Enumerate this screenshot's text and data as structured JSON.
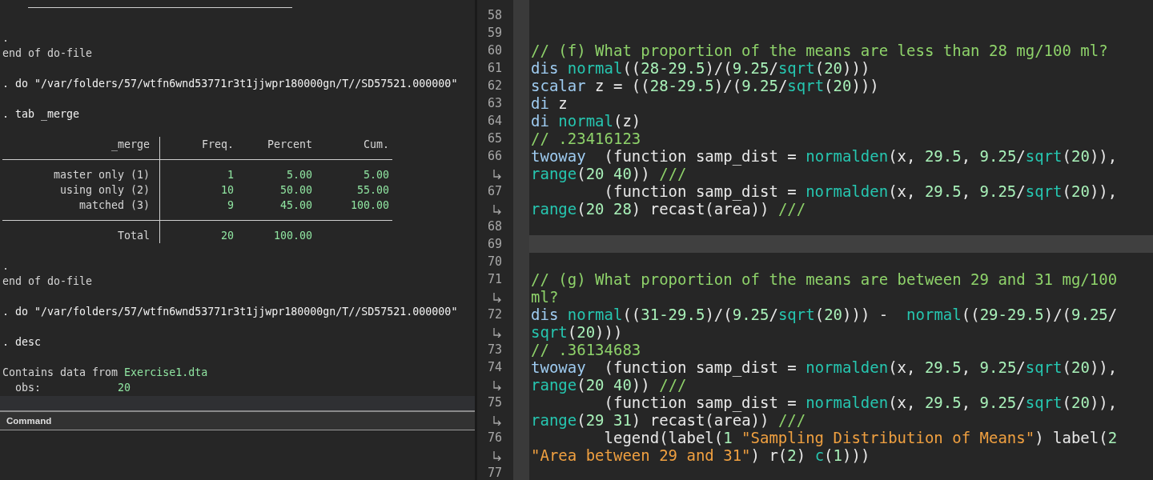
{
  "results": {
    "entries": [
      {
        "kind": "rule"
      },
      {
        "kind": "blank"
      },
      {
        "kind": "line",
        "segments": [
          {
            "kind": "plain",
            "text": "."
          }
        ]
      },
      {
        "kind": "line",
        "segments": [
          {
            "kind": "plain",
            "text": "end of do-file"
          }
        ]
      },
      {
        "kind": "blank"
      },
      {
        "kind": "line",
        "segments": [
          {
            "kind": "command",
            "text": ". do \"/var/folders/57/wtfn6wnd53771r3t1jjwpr180000gn/T//SD57521.000000\""
          }
        ]
      },
      {
        "kind": "blank"
      },
      {
        "kind": "line",
        "segments": [
          {
            "kind": "command",
            "text": ". tab _merge"
          }
        ]
      },
      {
        "kind": "blank"
      },
      {
        "kind": "table",
        "columns": [
          "_merge",
          "Freq.",
          "Percent",
          "Cum."
        ],
        "rows": [
          [
            "master only (1)",
            "1",
            "5.00",
            "5.00"
          ],
          [
            "using only (2)",
            "10",
            "50.00",
            "55.00"
          ],
          [
            "matched (3)",
            "9",
            "45.00",
            "100.00"
          ]
        ],
        "total": [
          "Total",
          "20",
          "100.00"
        ]
      },
      {
        "kind": "blank"
      },
      {
        "kind": "line",
        "segments": [
          {
            "kind": "plain",
            "text": "."
          }
        ]
      },
      {
        "kind": "line",
        "segments": [
          {
            "kind": "plain",
            "text": "end of do-file"
          }
        ]
      },
      {
        "kind": "blank"
      },
      {
        "kind": "line",
        "segments": [
          {
            "kind": "command",
            "text": ". do \"/var/folders/57/wtfn6wnd53771r3t1jjwpr180000gn/T//SD57521.000000\""
          }
        ]
      },
      {
        "kind": "blank"
      },
      {
        "kind": "line",
        "segments": [
          {
            "kind": "command",
            "text": ". desc"
          }
        ]
      },
      {
        "kind": "blank"
      },
      {
        "kind": "line",
        "segments": [
          {
            "kind": "plain",
            "text": "Contains data from "
          },
          {
            "kind": "result",
            "text": "Exercise1.dta"
          }
        ]
      },
      {
        "kind": "line",
        "segments": [
          {
            "kind": "plain",
            "text": "  obs:            "
          },
          {
            "kind": "result",
            "text": "20"
          }
        ]
      }
    ]
  },
  "command": {
    "title": "Command"
  },
  "editor": {
    "lines": [
      {
        "number": "58",
        "current": false
      },
      {
        "number": "59",
        "current": false
      },
      {
        "number": "60",
        "current": false,
        "wraps": [
          {
            "tokens": [
              {
                "kind": "comment",
                "text": "// (f) What proportion of the means are less than 28 mg/100 ml?"
              }
            ]
          }
        ]
      },
      {
        "number": "61",
        "current": false,
        "wraps": [
          {
            "tokens": [
              {
                "kind": "keyword",
                "text": "dis "
              },
              {
                "kind": "function",
                "text": "normal"
              },
              {
                "kind": "plain",
                "text": "(("
              },
              {
                "kind": "number",
                "text": "28-29.5"
              },
              {
                "kind": "plain",
                "text": ")/("
              },
              {
                "kind": "number",
                "text": "9.25"
              },
              {
                "kind": "plain",
                "text": "/"
              },
              {
                "kind": "function",
                "text": "sqrt"
              },
              {
                "kind": "plain",
                "text": "("
              },
              {
                "kind": "number",
                "text": "20"
              },
              {
                "kind": "plain",
                "text": ")))"
              }
            ]
          }
        ]
      },
      {
        "number": "62",
        "current": false,
        "wraps": [
          {
            "tokens": [
              {
                "kind": "keyword",
                "text": "scalar"
              },
              {
                "kind": "plain",
                "text": " z = (("
              },
              {
                "kind": "number",
                "text": "28-29.5"
              },
              {
                "kind": "plain",
                "text": ")/("
              },
              {
                "kind": "number",
                "text": "9.25"
              },
              {
                "kind": "plain",
                "text": "/"
              },
              {
                "kind": "function",
                "text": "sqrt"
              },
              {
                "kind": "plain",
                "text": "("
              },
              {
                "kind": "number",
                "text": "20"
              },
              {
                "kind": "plain",
                "text": ")))"
              }
            ]
          }
        ]
      },
      {
        "number": "63",
        "current": false,
        "wraps": [
          {
            "tokens": [
              {
                "kind": "keyword",
                "text": "di"
              },
              {
                "kind": "plain",
                "text": " z"
              }
            ]
          }
        ]
      },
      {
        "number": "64",
        "current": false,
        "wraps": [
          {
            "tokens": [
              {
                "kind": "keyword",
                "text": "di "
              },
              {
                "kind": "function",
                "text": "normal"
              },
              {
                "kind": "plain",
                "text": "(z)"
              }
            ]
          }
        ]
      },
      {
        "number": "65",
        "current": false,
        "wraps": [
          {
            "tokens": [
              {
                "kind": "comment",
                "text": "// .23416123"
              }
            ]
          }
        ]
      },
      {
        "number": "66",
        "current": false,
        "wraps": [
          {
            "tokens": [
              {
                "kind": "keyword",
                "text": "twoway"
              },
              {
                "kind": "plain",
                "text": "  (function samp_dist = "
              },
              {
                "kind": "function",
                "text": "normalden"
              },
              {
                "kind": "plain",
                "text": "(x, "
              },
              {
                "kind": "number",
                "text": "29.5"
              },
              {
                "kind": "plain",
                "text": ", "
              },
              {
                "kind": "number",
                "text": "9.25"
              },
              {
                "kind": "plain",
                "text": "/"
              },
              {
                "kind": "function",
                "text": "sqrt"
              },
              {
                "kind": "plain",
                "text": "("
              },
              {
                "kind": "number",
                "text": "20"
              },
              {
                "kind": "plain",
                "text": ")),"
              }
            ]
          },
          {
            "tokens": [
              {
                "kind": "function",
                "text": "range"
              },
              {
                "kind": "plain",
                "text": "("
              },
              {
                "kind": "number",
                "text": "20 40"
              },
              {
                "kind": "plain",
                "text": ")) "
              },
              {
                "kind": "comment",
                "text": "///"
              }
            ]
          }
        ]
      },
      {
        "number": "67",
        "current": false,
        "wraps": [
          {
            "tokens": [
              {
                "kind": "plain",
                "text": "        (function samp_dist = "
              },
              {
                "kind": "function",
                "text": "normalden"
              },
              {
                "kind": "plain",
                "text": "(x, "
              },
              {
                "kind": "number",
                "text": "29.5"
              },
              {
                "kind": "plain",
                "text": ", "
              },
              {
                "kind": "number",
                "text": "9.25"
              },
              {
                "kind": "plain",
                "text": "/"
              },
              {
                "kind": "function",
                "text": "sqrt"
              },
              {
                "kind": "plain",
                "text": "("
              },
              {
                "kind": "number",
                "text": "20"
              },
              {
                "kind": "plain",
                "text": ")),"
              }
            ]
          },
          {
            "tokens": [
              {
                "kind": "function",
                "text": "range"
              },
              {
                "kind": "plain",
                "text": "("
              },
              {
                "kind": "number",
                "text": "20 28"
              },
              {
                "kind": "plain",
                "text": ") recast(area)) "
              },
              {
                "kind": "comment",
                "text": "///"
              }
            ]
          }
        ]
      },
      {
        "number": "68",
        "current": false
      },
      {
        "number": "69",
        "current": true
      },
      {
        "number": "70",
        "current": false
      },
      {
        "number": "71",
        "current": false,
        "wraps": [
          {
            "tokens": [
              {
                "kind": "comment",
                "text": "// (g) What proportion of the means are between 29 and 31 mg/100"
              }
            ]
          },
          {
            "tokens": [
              {
                "kind": "comment",
                "text": "ml?"
              }
            ]
          }
        ]
      },
      {
        "number": "72",
        "current": false,
        "wraps": [
          {
            "tokens": [
              {
                "kind": "keyword",
                "text": "dis "
              },
              {
                "kind": "function",
                "text": "normal"
              },
              {
                "kind": "plain",
                "text": "(("
              },
              {
                "kind": "number",
                "text": "31-29.5"
              },
              {
                "kind": "plain",
                "text": ")/("
              },
              {
                "kind": "number",
                "text": "9.25"
              },
              {
                "kind": "plain",
                "text": "/"
              },
              {
                "kind": "function",
                "text": "sqrt"
              },
              {
                "kind": "plain",
                "text": "("
              },
              {
                "kind": "number",
                "text": "20"
              },
              {
                "kind": "plain",
                "text": "))) -  "
              },
              {
                "kind": "function",
                "text": "normal"
              },
              {
                "kind": "plain",
                "text": "(("
              },
              {
                "kind": "number",
                "text": "29-29.5"
              },
              {
                "kind": "plain",
                "text": ")/("
              },
              {
                "kind": "number",
                "text": "9.25"
              },
              {
                "kind": "plain",
                "text": "/"
              }
            ]
          },
          {
            "tokens": [
              {
                "kind": "function",
                "text": "sqrt"
              },
              {
                "kind": "plain",
                "text": "("
              },
              {
                "kind": "number",
                "text": "20"
              },
              {
                "kind": "plain",
                "text": ")))"
              }
            ]
          }
        ]
      },
      {
        "number": "73",
        "current": false,
        "wraps": [
          {
            "tokens": [
              {
                "kind": "comment",
                "text": "// .36134683"
              }
            ]
          }
        ]
      },
      {
        "number": "74",
        "current": false,
        "wraps": [
          {
            "tokens": [
              {
                "kind": "keyword",
                "text": "twoway"
              },
              {
                "kind": "plain",
                "text": "  (function samp_dist = "
              },
              {
                "kind": "function",
                "text": "normalden"
              },
              {
                "kind": "plain",
                "text": "(x, "
              },
              {
                "kind": "number",
                "text": "29.5"
              },
              {
                "kind": "plain",
                "text": ", "
              },
              {
                "kind": "number",
                "text": "9.25"
              },
              {
                "kind": "plain",
                "text": "/"
              },
              {
                "kind": "function",
                "text": "sqrt"
              },
              {
                "kind": "plain",
                "text": "("
              },
              {
                "kind": "number",
                "text": "20"
              },
              {
                "kind": "plain",
                "text": ")),"
              }
            ]
          },
          {
            "tokens": [
              {
                "kind": "function",
                "text": "range"
              },
              {
                "kind": "plain",
                "text": "("
              },
              {
                "kind": "number",
                "text": "20 40"
              },
              {
                "kind": "plain",
                "text": ")) "
              },
              {
                "kind": "comment",
                "text": "///"
              }
            ]
          }
        ]
      },
      {
        "number": "75",
        "current": false,
        "wraps": [
          {
            "tokens": [
              {
                "kind": "plain",
                "text": "        (function samp_dist = "
              },
              {
                "kind": "function",
                "text": "normalden"
              },
              {
                "kind": "plain",
                "text": "(x, "
              },
              {
                "kind": "number",
                "text": "29.5"
              },
              {
                "kind": "plain",
                "text": ", "
              },
              {
                "kind": "number",
                "text": "9.25"
              },
              {
                "kind": "plain",
                "text": "/"
              },
              {
                "kind": "function",
                "text": "sqrt"
              },
              {
                "kind": "plain",
                "text": "("
              },
              {
                "kind": "number",
                "text": "20"
              },
              {
                "kind": "plain",
                "text": ")),"
              }
            ]
          },
          {
            "tokens": [
              {
                "kind": "function",
                "text": "range"
              },
              {
                "kind": "plain",
                "text": "("
              },
              {
                "kind": "number",
                "text": "29 31"
              },
              {
                "kind": "plain",
                "text": ") recast(area)) "
              },
              {
                "kind": "comment",
                "text": "///"
              }
            ]
          }
        ]
      },
      {
        "number": "76",
        "current": false,
        "wraps": [
          {
            "tokens": [
              {
                "kind": "plain",
                "text": "        legend(label("
              },
              {
                "kind": "number",
                "text": "1 "
              },
              {
                "kind": "string",
                "text": "\"Sampling Distribution of Means\""
              },
              {
                "kind": "plain",
                "text": ") label("
              },
              {
                "kind": "number",
                "text": "2"
              }
            ]
          },
          {
            "tokens": [
              {
                "kind": "string",
                "text": "\"Area between 29 and 31\""
              },
              {
                "kind": "plain",
                "text": ") r("
              },
              {
                "kind": "number",
                "text": "2"
              },
              {
                "kind": "plain",
                "text": ") "
              },
              {
                "kind": "function",
                "text": "c"
              },
              {
                "kind": "plain",
                "text": "("
              },
              {
                "kind": "number",
                "text": "1"
              },
              {
                "kind": "plain",
                "text": ")))"
              }
            ]
          }
        ]
      },
      {
        "number": "77",
        "current": false
      }
    ]
  }
}
